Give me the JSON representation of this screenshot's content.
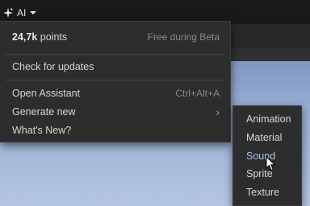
{
  "topbar": {
    "ai_label": "AI",
    "ai_icon": "sparkle-icon",
    "dropdown_icon": "caret-down-icon"
  },
  "menu": {
    "points_value": "24,7k",
    "points_unit": "points",
    "points_note": "Free during Beta",
    "check_updates": "Check for updates",
    "open_assistant": "Open Assistant",
    "open_assistant_shortcut": "Ctrl+Alt+A",
    "generate_new": "Generate new",
    "submenu_arrow": "›",
    "whats_new": "What's New?"
  },
  "submenu": {
    "items": [
      "Animation",
      "Material",
      "Sound",
      "Sprite",
      "Texture"
    ],
    "hovered": "Sound"
  },
  "colors": {
    "menu_bg": "#2d2d2d",
    "hover_text": "#a9c3ea",
    "viewport_sky": "#9bb1d6"
  }
}
